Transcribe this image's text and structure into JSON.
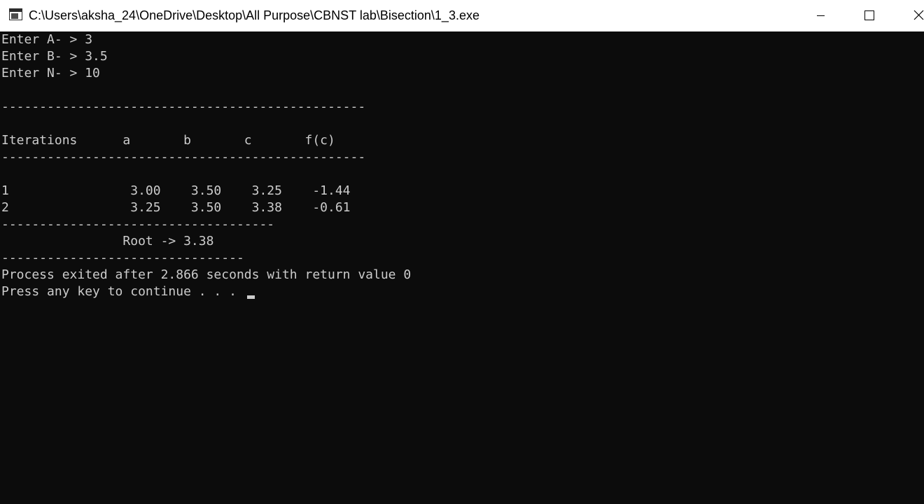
{
  "window": {
    "title": "C:\\Users\\aksha_24\\OneDrive\\Desktop\\All Purpose\\CBNST lab\\Bisection\\1_3.exe",
    "controls": [
      "minimize",
      "maximize",
      "close"
    ]
  },
  "console": {
    "lines": [
      "Enter A- > 3",
      "Enter B- > 3.5",
      "Enter N- > 10",
      "",
      "------------------------------------------------",
      "",
      "Iterations      a       b       c       f(c)",
      "------------------------------------------------",
      "",
      "1                3.00    3.50    3.25    -1.44",
      "2                3.25    3.50    3.38    -0.61",
      "------------------------------------",
      "                Root -> 3.38",
      "--------------------------------",
      "Process exited after 2.866 seconds with return value 0",
      "Press any key to continue . . . "
    ]
  },
  "colors": {
    "console_bg": "#0c0c0c",
    "console_fg": "#cccccc",
    "titlebar_bg": "#ffffff",
    "titlebar_fg": "#000000"
  }
}
